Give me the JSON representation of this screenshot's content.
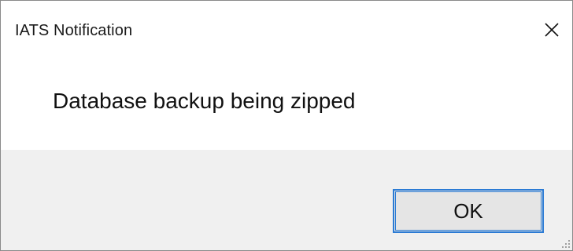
{
  "window": {
    "title": "IATS Notification",
    "close_icon": "close-icon"
  },
  "message": {
    "text": "Database backup being zipped"
  },
  "buttons": {
    "ok_label": "OK"
  },
  "colors": {
    "accent": "#2b7bd4",
    "footer_bg": "#f0f0f0",
    "button_bg": "#e5e5e5"
  }
}
